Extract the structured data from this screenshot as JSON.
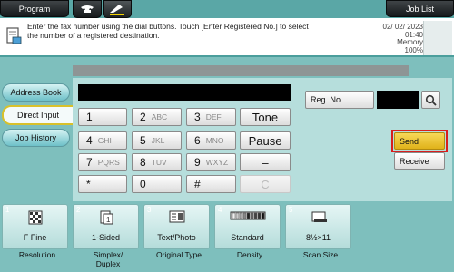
{
  "top": {
    "program_label": "Program",
    "job_list_label": "Job List"
  },
  "message": {
    "text": "Enter the fax number using the dial buttons. Touch [Enter Registered No.] to select the number of a registered destination.",
    "date": "02/ 02/ 2023",
    "time": "01:40",
    "memory_label": "Memory",
    "memory_value": "100%"
  },
  "tabs": [
    {
      "label": "Address Book"
    },
    {
      "label": "Direct Input"
    },
    {
      "label": "Job History"
    }
  ],
  "keypad": {
    "k1": "1",
    "k2": "2",
    "k2l": "ABC",
    "k3": "3",
    "k3l": "DEF",
    "k4": "4",
    "k4l": "GHI",
    "k5": "5",
    "k5l": "JKL",
    "k6": "6",
    "k6l": "MNO",
    "k7": "7",
    "k7l": "PQRS",
    "k8": "8",
    "k8l": "TUV",
    "k9": "9",
    "k9l": "WXYZ",
    "kstar": "*",
    "k0": "0",
    "khash": "#",
    "tone": "Tone",
    "pause": "Pause",
    "dash": "–",
    "clear": "C"
  },
  "right": {
    "reg_no_label": "Reg. No.",
    "send_label": "Send",
    "receive_label": "Receive"
  },
  "settings": [
    {
      "index": "1",
      "value": "F Fine",
      "label": "Resolution"
    },
    {
      "index": "2",
      "value": "1-Sided",
      "label": "Simplex/\nDuplex"
    },
    {
      "index": "3",
      "value": "Text/Photo",
      "label": "Original Type"
    },
    {
      "index": "4",
      "value": "Standard",
      "label": "Density"
    },
    {
      "index": "5",
      "value": "8½×11",
      "label": "Scan Size"
    }
  ],
  "colors": {
    "background": "#7ebfbd",
    "panel": "#b6dedc",
    "send_highlight": "#e0b21a",
    "send_border": "#d81e1e"
  }
}
